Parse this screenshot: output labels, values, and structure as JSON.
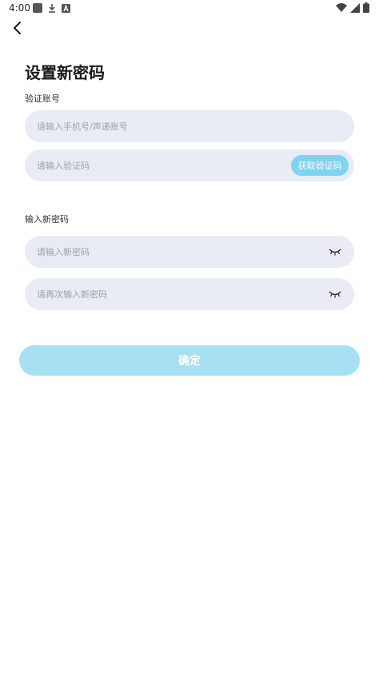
{
  "status_bar": {
    "time": "4:00",
    "left_icons": [
      "notification-square-icon",
      "download-icon",
      "app-a-icon"
    ],
    "right_icons": [
      "wifi-icon",
      "signal-icon",
      "battery-icon"
    ]
  },
  "nav": {
    "back_icon": "chevron-left-icon"
  },
  "page": {
    "title": "设置新密码"
  },
  "verify_section": {
    "label": "验证账号",
    "account_placeholder": "请输入手机号/声递账号",
    "code_placeholder": "请输入验证码",
    "get_code_label": "获取验证码"
  },
  "password_section": {
    "label": "输入新密码",
    "new_password_placeholder": "请输入新密码",
    "confirm_password_placeholder": "请再次输入新密码",
    "toggle_icon": "eye-closed-icon"
  },
  "submit": {
    "label": "确定"
  },
  "colors": {
    "field_bg": "#e9ecf4",
    "code_button": "#7fd4f1",
    "confirm_button": "#a7e0f3",
    "text_primary": "#1a1a1a",
    "placeholder": "#9ca0ab"
  }
}
